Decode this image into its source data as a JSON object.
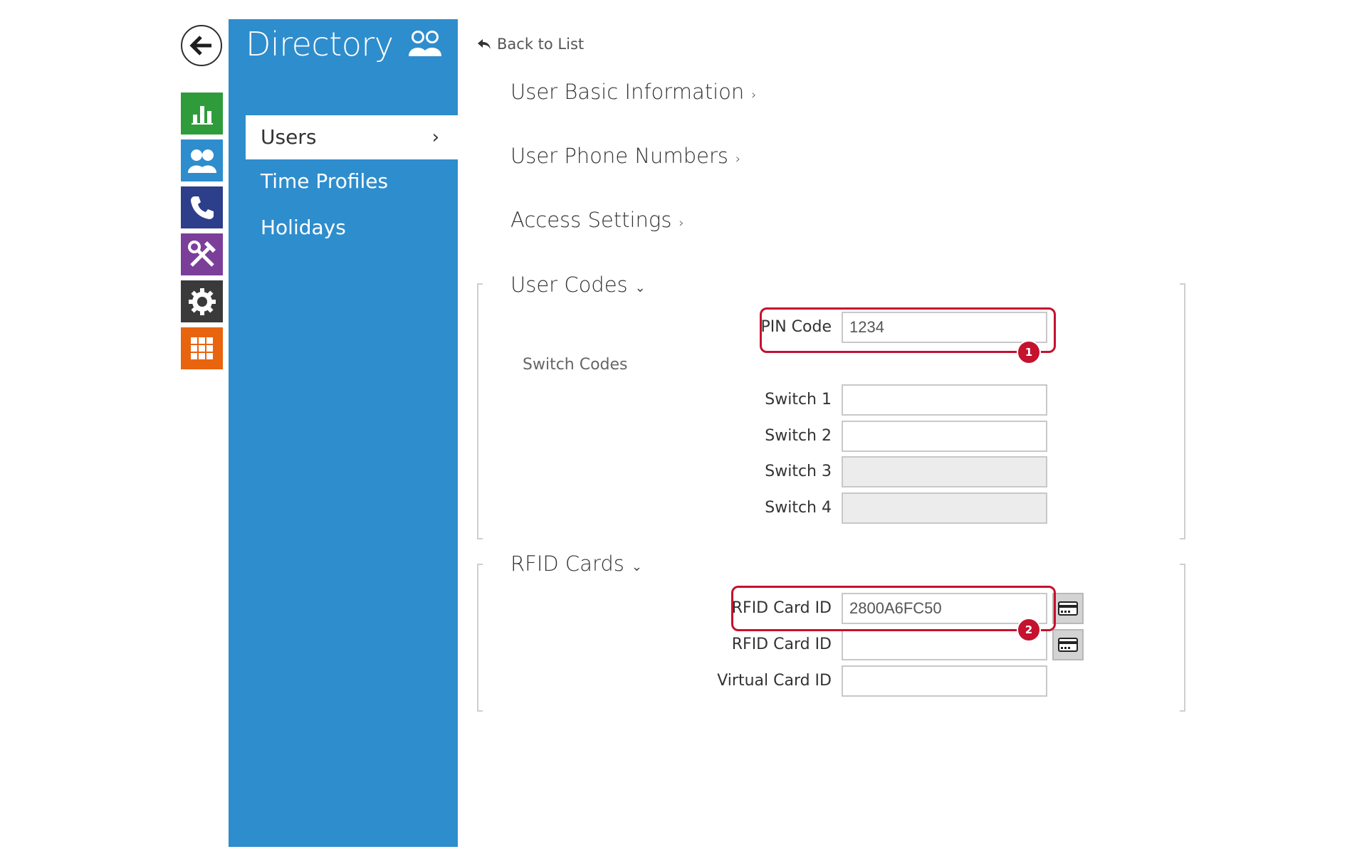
{
  "sidebar": {
    "title": "Directory",
    "items": [
      {
        "label": "Users",
        "active": true
      },
      {
        "label": "Time Profiles"
      },
      {
        "label": "Holidays"
      }
    ],
    "rail_icons": [
      "back-arrow-icon",
      "status-chart-icon",
      "directory-users-icon",
      "phone-icon",
      "hardware-tools-icon",
      "services-gear-icon",
      "system-grid-icon"
    ]
  },
  "content": {
    "back_link": "Back to List",
    "sections": {
      "basic": "User Basic Information",
      "phone": "User Phone Numbers",
      "access": "Access Settings",
      "codes": "User Codes",
      "rfid": "RFID Cards"
    },
    "pin": {
      "label": "PIN Code",
      "value": "1234"
    },
    "switch_codes_label": "Switch Codes",
    "switches": [
      {
        "label": "Switch 1",
        "value": ""
      },
      {
        "label": "Switch 2",
        "value": ""
      },
      {
        "label": "Switch 3",
        "value": ""
      },
      {
        "label": "Switch 4",
        "value": ""
      }
    ],
    "rfid_cards": [
      {
        "label": "RFID Card ID",
        "value": "2800A6FC50"
      },
      {
        "label": "RFID Card ID",
        "value": ""
      }
    ],
    "virtual_card": {
      "label": "Virtual Card ID",
      "value": ""
    },
    "callouts": [
      "1",
      "2"
    ]
  },
  "colors": {
    "panel_blue": "#2e8dcd",
    "callout_red": "#c4122f"
  }
}
